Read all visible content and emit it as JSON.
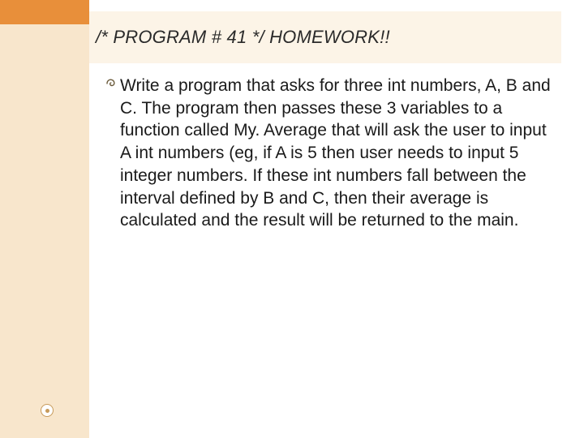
{
  "slide": {
    "title": "/* PROGRAM # 41 */  HOMEWORK!!",
    "bullet_text": "Write a program that asks for three int numbers, A, B and C. The program then passes these 3 variables to a function called My. Average that will ask the user to input A int numbers (eg, if A is 5 then user needs to input 5 integer numbers. If these int numbers fall between the interval defined by B and C, then their average is calculated and the result will be returned to the main."
  }
}
